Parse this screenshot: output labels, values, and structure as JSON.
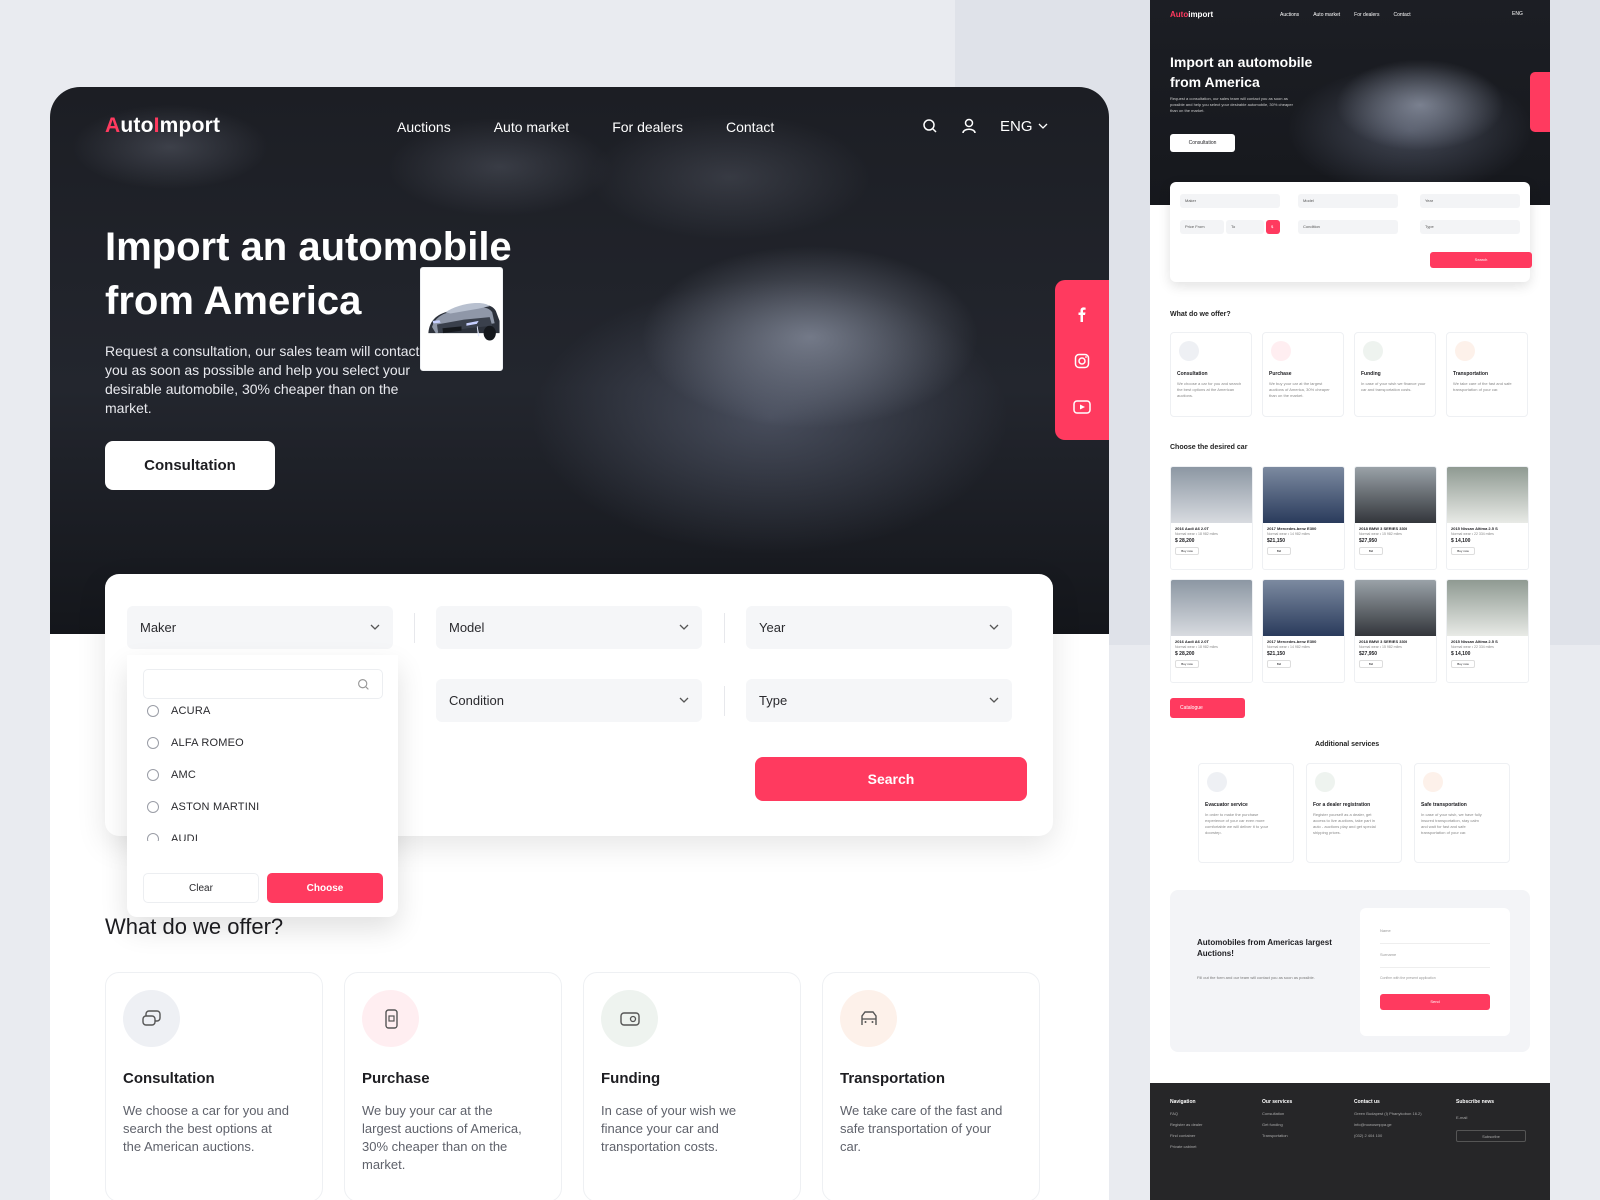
{
  "brand": {
    "prefix": "A",
    "rest_before": "uto",
    "i_red": "I",
    "rest_after": "mport"
  },
  "nav": [
    "Auctions",
    "Auto market",
    "For dealers",
    "Contact"
  ],
  "header": {
    "lang": "ENG",
    "icons": [
      "search-icon",
      "user-icon",
      "chevron-down-icon"
    ]
  },
  "hero": {
    "title": "Import an automobile from America",
    "description": "Request a consultation, our sales team will contact you as soon as possible and help you select your desirable automobile, 30% cheaper than on the market.",
    "cta": "Consultation"
  },
  "social": [
    "facebook-icon",
    "instagram-icon",
    "youtube-icon"
  ],
  "filters": {
    "maker": "Maker",
    "model": "Model",
    "year": "Year",
    "condition": "Condition",
    "type": "Type",
    "search": "Search"
  },
  "maker_dropdown": {
    "options": [
      "ACURA",
      "ALFA ROMEO",
      "AMC",
      "ASTON MARTINI",
      "AUDI"
    ],
    "clear": "Clear",
    "choose": "Choose"
  },
  "offer": {
    "title": "What do we offer?",
    "items": [
      {
        "title": "Consultation",
        "desc": "We choose a car for you and search the best options at the American auctions.",
        "icon": "chat-icon",
        "bg": "#eef0f4"
      },
      {
        "title": "Purchase",
        "desc": "We buy your car at the largest auctions of America, 30% cheaper than on the market.",
        "icon": "phone-icon",
        "bg": "#ffeef1"
      },
      {
        "title": "Funding",
        "desc": "In case of your wish we finance your car and transportation costs.",
        "icon": "money-icon",
        "bg": "#eef3ef"
      },
      {
        "title": "Transportation",
        "desc": "We take care of the fast and safe transportation of your car.",
        "icon": "truck-icon",
        "bg": "#fdf1ea"
      }
    ]
  },
  "colors": {
    "accent": "#ff3a5f",
    "dark": "#1d1d21"
  },
  "preview": {
    "logo_prefix": "Auto",
    "logo_suffix": "import",
    "nav": [
      "Auctions",
      "Auto market",
      "For dealers",
      "Contact"
    ],
    "lang": "ENG",
    "title": "Import an automobile from America",
    "desc": "Request a consultation, our sales team will contact you as soon as possible and help you select your desirable automobile, 30% cheaper than on the market.",
    "cta": "Consultation",
    "fields": {
      "maker": "Maker",
      "model": "Model",
      "year": "Year",
      "price_from": "Price From",
      "price_to": "To",
      "condition": "Condition",
      "type": "Type",
      "search": "Search"
    },
    "offer_title": "What do we offer?",
    "offers": [
      {
        "t": "Consultation",
        "d": "We choose a car for you and search the best options at the American auctions."
      },
      {
        "t": "Purchase",
        "d": "We buy your car at the largest auctions of America, 30% cheaper than on the market."
      },
      {
        "t": "Funding",
        "d": "In case of your wish we finance your car and transportation costs."
      },
      {
        "t": "Transportation",
        "d": "We take care of the fast and safe transportation of your car."
      }
    ],
    "cars_title": "Choose the desired car",
    "cars": [
      {
        "n": "2016 Audi A6 2.0T",
        "m": "Normal wear • 18 982 miles",
        "p": "$ 28,200",
        "b": "Buy now"
      },
      {
        "n": "2017 Mercedes-benz E300",
        "m": "Normal wear • 14 982 miles",
        "p": "$21,150",
        "b": "Bid"
      },
      {
        "n": "2018 BMW 3 SERIES 330I",
        "m": "Normal wear • 15 982 miles",
        "p": "$27,950",
        "b": "Bid"
      },
      {
        "n": "2015 Nissan Altima 2.5 S",
        "m": "Normal wear • 22 334 miles",
        "p": "$ 14,100",
        "b": "Buy now"
      },
      {
        "n": "2016 Audi A6 2.0T",
        "m": "Normal wear • 18 982 miles",
        "p": "$ 28,200",
        "b": "Buy now"
      },
      {
        "n": "2017 Mercedes-benz E300",
        "m": "Normal wear • 14 982 miles",
        "p": "$21,150",
        "b": "Bid"
      },
      {
        "n": "2018 BMW 3 SERIES 330I",
        "m": "Normal wear • 15 982 miles",
        "p": "$27,950",
        "b": "Bid"
      },
      {
        "n": "2015 Nissan Altima 2.5 S",
        "m": "Normal wear • 22 334 miles",
        "p": "$ 14,100",
        "b": "Buy now"
      }
    ],
    "catalogue": "Catalogue",
    "additional_title": "Additional services",
    "additional": [
      {
        "t": "Evacuator service",
        "d": "In order to make the purchase experience of your car even more comfortable we will deliver it to your doorstep."
      },
      {
        "t": "For a dealer registration",
        "d": "Register yourself as a dealer, get access to live auctions, take part in auto - auctions play and get special shipping prices."
      },
      {
        "t": "Safe transportation",
        "d": "In case of your wish, we have fully insured transportation, stay calm and wait for fast and safe transportation of your car."
      }
    ],
    "form": {
      "title": "Automobiles from Americas largest Auctions!",
      "desc": "Fill out the form and our team will contact you as soon as possible.",
      "name": "Name",
      "surname": "Surname",
      "confirm": "Confirm with the present application",
      "send": "Send"
    },
    "footer": {
      "nav_title": "Navigation",
      "nav": [
        "FAQ",
        "Register as dealer",
        "Find container",
        "Private cabinet"
      ],
      "services_title": "Our services",
      "services": [
        "Consultation",
        "Get funding",
        "Transportation"
      ],
      "contact_title": "Contact us",
      "contact": [
        "Green Budapest (I) Phanykobon 16.2)",
        "info@nowosmppa.ge",
        "(032) 2 404 100"
      ],
      "subscribe_title": "Subscribe news",
      "email": "E-mail",
      "subscribe": "Subscribe"
    }
  }
}
